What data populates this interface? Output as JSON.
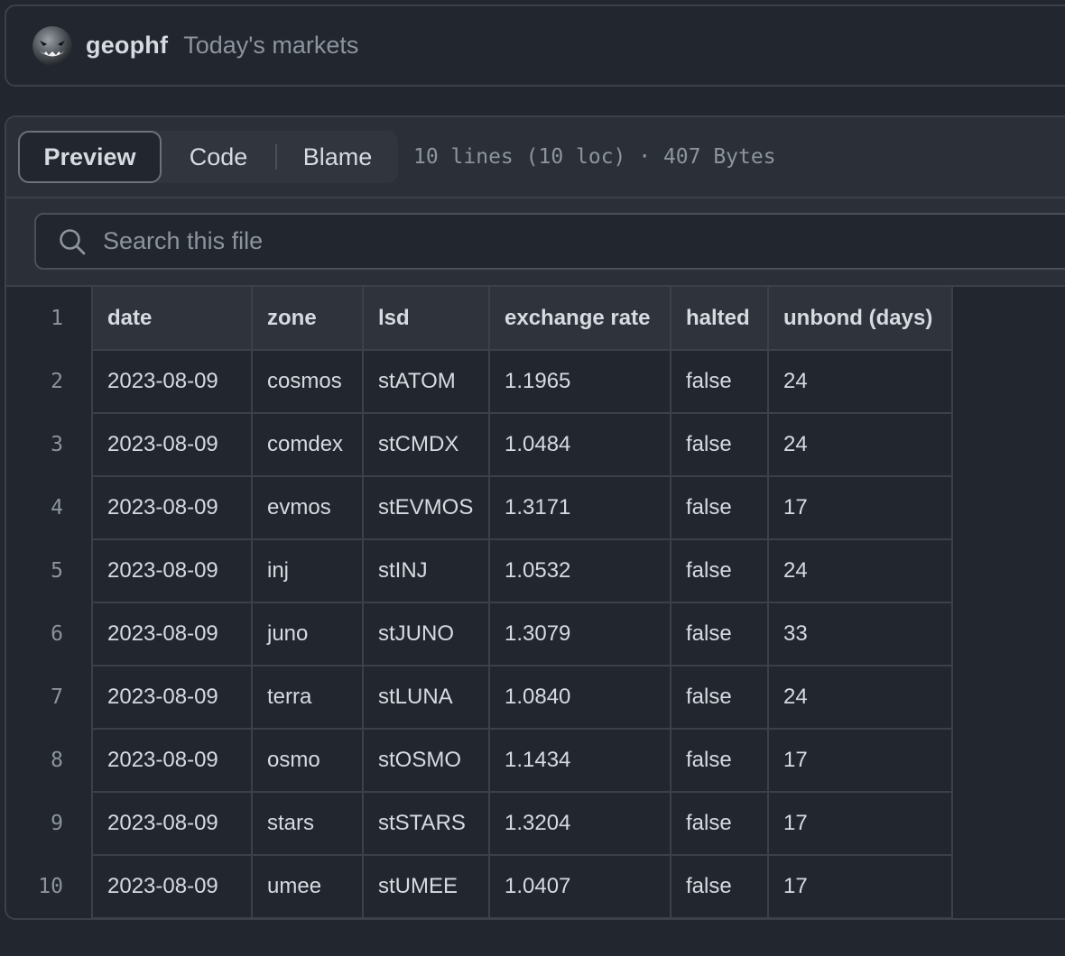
{
  "commit": {
    "username": "geophf",
    "message": "Today's markets"
  },
  "file": {
    "view_tabs": [
      {
        "label": "Preview",
        "active": true
      },
      {
        "label": "Code",
        "active": false
      },
      {
        "label": "Blame",
        "active": false
      }
    ],
    "meta": "10 lines (10 loc) · 407 Bytes"
  },
  "search": {
    "placeholder": "Search this file",
    "icon": "search-icon"
  },
  "table": {
    "line_numbers": [
      "1",
      "2",
      "3",
      "4",
      "5",
      "6",
      "7",
      "8",
      "9",
      "10"
    ],
    "headers": [
      "date",
      "zone",
      "lsd",
      "exchange rate",
      "halted",
      "unbond (days)"
    ],
    "rows": [
      [
        "2023-08-09",
        "cosmos",
        "stATOM",
        "1.1965",
        "false",
        "24"
      ],
      [
        "2023-08-09",
        "comdex",
        "stCMDX",
        "1.0484",
        "false",
        "24"
      ],
      [
        "2023-08-09",
        "evmos",
        "stEVMOS",
        "1.3171",
        "false",
        "17"
      ],
      [
        "2023-08-09",
        "inj",
        "stINJ",
        "1.0532",
        "false",
        "24"
      ],
      [
        "2023-08-09",
        "juno",
        "stJUNO",
        "1.3079",
        "false",
        "33"
      ],
      [
        "2023-08-09",
        "terra",
        "stLUNA",
        "1.0840",
        "false",
        "24"
      ],
      [
        "2023-08-09",
        "osmo",
        "stOSMO",
        "1.1434",
        "false",
        "17"
      ],
      [
        "2023-08-09",
        "stars",
        "stSTARS",
        "1.3204",
        "false",
        "17"
      ],
      [
        "2023-08-09",
        "umee",
        "stUMEE",
        "1.0407",
        "false",
        "17"
      ]
    ]
  },
  "colors": {
    "background": "#22262e",
    "toolbar": "#2b3038",
    "border": "#3b414a",
    "text": "#d6dbe1",
    "muted_text": "#8c949e"
  }
}
